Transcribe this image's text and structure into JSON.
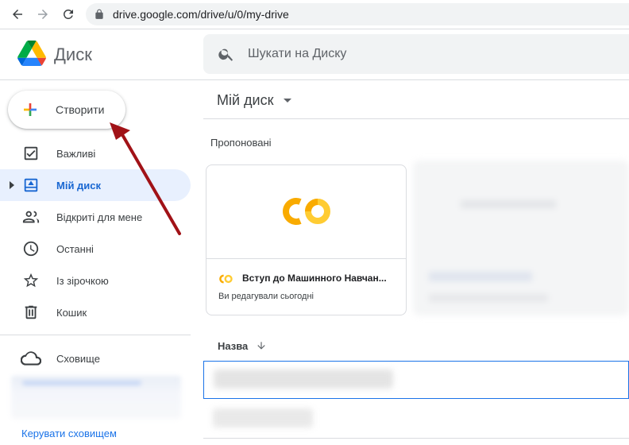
{
  "browser": {
    "back_icon": "arrow-left-icon",
    "forward_icon": "arrow-right-icon",
    "reload_icon": "reload-icon",
    "url": "drive.google.com/drive/u/0/my-drive"
  },
  "header": {
    "app_name": "Диск",
    "search_placeholder": "Шукати на Диску"
  },
  "sidebar": {
    "create_label": "Створити",
    "items": [
      {
        "label": "Важливі",
        "icon": "priority-checkbox-icon"
      },
      {
        "label": "Мій диск",
        "icon": "my-drive-icon",
        "active": true
      },
      {
        "label": "Відкриті для мене",
        "icon": "shared-people-icon"
      },
      {
        "label": "Останні",
        "icon": "clock-icon"
      },
      {
        "label": "Із зірочкою",
        "icon": "star-icon"
      },
      {
        "label": "Кошик",
        "icon": "trash-icon"
      }
    ],
    "storage_label": "Сховище",
    "manage_storage": "Керувати сховищем"
  },
  "main": {
    "title": "Мій диск",
    "suggested_label": "Пропоновані",
    "card": {
      "name": "Вступ до Машинного Навчан...",
      "subtitle": "Ви редагували сьогодні"
    },
    "column_name": "Назва"
  },
  "colors": {
    "accent": "#1a73e8",
    "active_bg": "#e8f0fe",
    "annotation_arrow": "#a11217",
    "colab_orange": "#f9ab00",
    "colab_yellow": "#ffcc33"
  }
}
